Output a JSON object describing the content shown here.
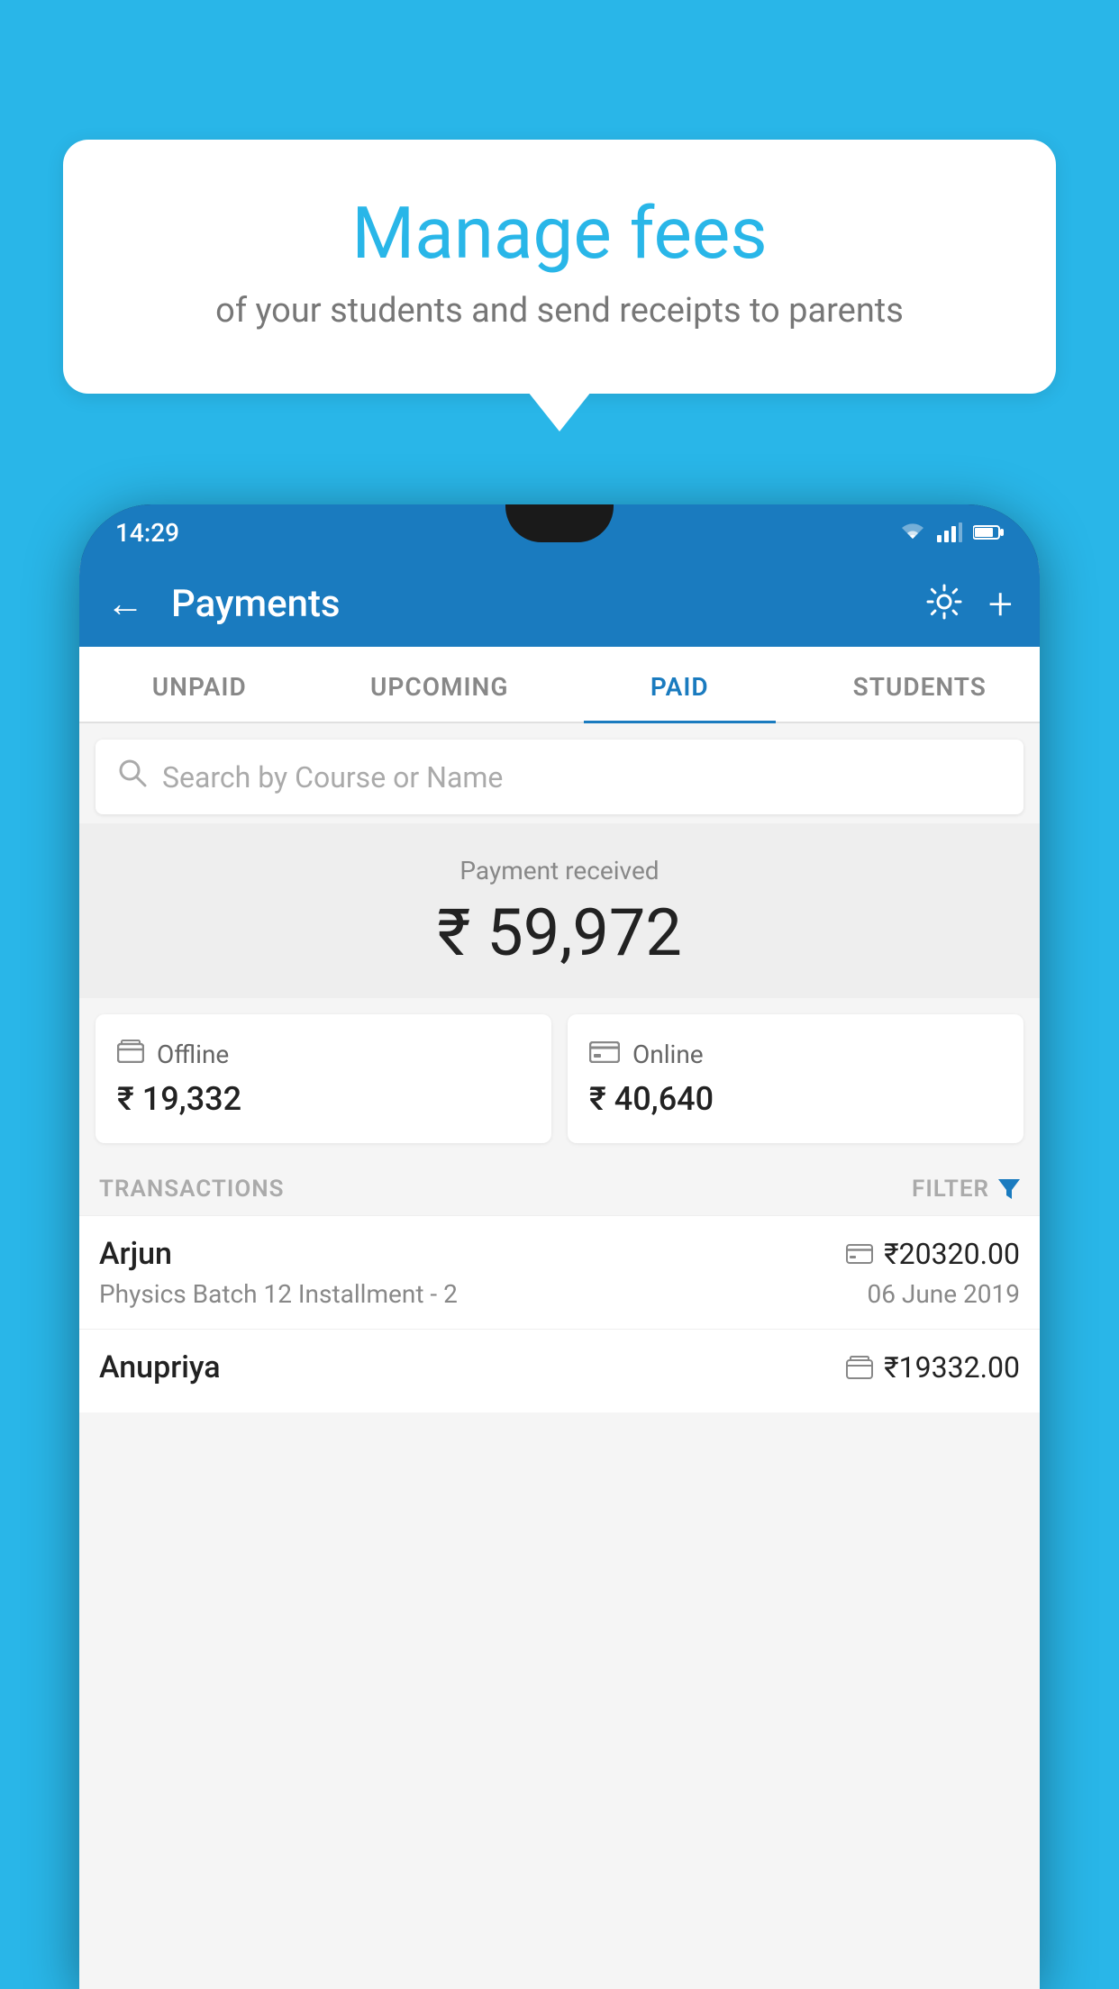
{
  "page": {
    "background_color": "#29B6E8"
  },
  "speech_bubble": {
    "title": "Manage fees",
    "subtitle": "of your students and send receipts to parents"
  },
  "status_bar": {
    "time": "14:29",
    "signal_icon": "signal",
    "wifi_icon": "wifi",
    "battery_icon": "battery"
  },
  "header": {
    "title": "Payments",
    "back_label": "←",
    "gear_label": "⚙",
    "plus_label": "+"
  },
  "tabs": [
    {
      "label": "UNPAID",
      "active": false
    },
    {
      "label": "UPCOMING",
      "active": false
    },
    {
      "label": "PAID",
      "active": true
    },
    {
      "label": "STUDENTS",
      "active": false
    }
  ],
  "search": {
    "placeholder": "Search by Course or Name"
  },
  "payment_received": {
    "label": "Payment received",
    "amount": "₹ 59,972"
  },
  "payment_cards": [
    {
      "label": "Offline",
      "amount": "₹ 19,332",
      "icon": "offline"
    },
    {
      "label": "Online",
      "amount": "₹ 40,640",
      "icon": "online"
    }
  ],
  "transactions_section": {
    "label": "TRANSACTIONS",
    "filter_label": "FILTER"
  },
  "transactions": [
    {
      "name": "Arjun",
      "course": "Physics Batch 12 Installment - 2",
      "amount": "₹20320.00",
      "date": "06 June 2019",
      "payment_type": "online"
    },
    {
      "name": "Anupriya",
      "course": "",
      "amount": "₹19332.00",
      "date": "",
      "payment_type": "offline"
    }
  ]
}
